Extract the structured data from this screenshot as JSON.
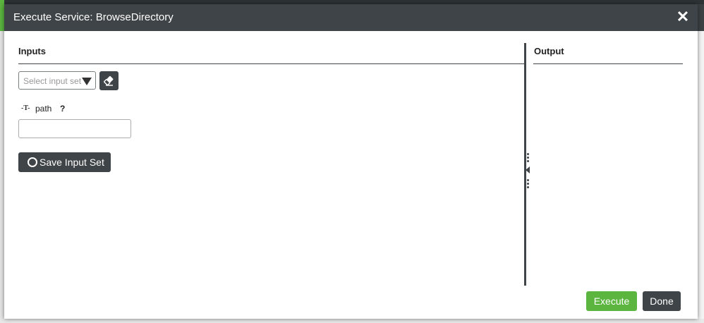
{
  "dialog": {
    "title": "Execute Service: BrowseDirectory",
    "close_glyph": "✕"
  },
  "inputs": {
    "heading": "Inputs",
    "input_set_select": {
      "placeholder": "Select input set"
    },
    "clear_icon": "eraser-icon",
    "parameters": [
      {
        "type_icon": "-T-",
        "name": "path",
        "help": "?",
        "value": ""
      }
    ],
    "save_button_label": "Save Input Set"
  },
  "output": {
    "heading": "Output"
  },
  "footer": {
    "execute_label": "Execute",
    "done_label": "Done"
  },
  "colors": {
    "header_bg": "#3e4447",
    "primary_green": "#5bb53f",
    "dark_button": "#3e4447"
  }
}
